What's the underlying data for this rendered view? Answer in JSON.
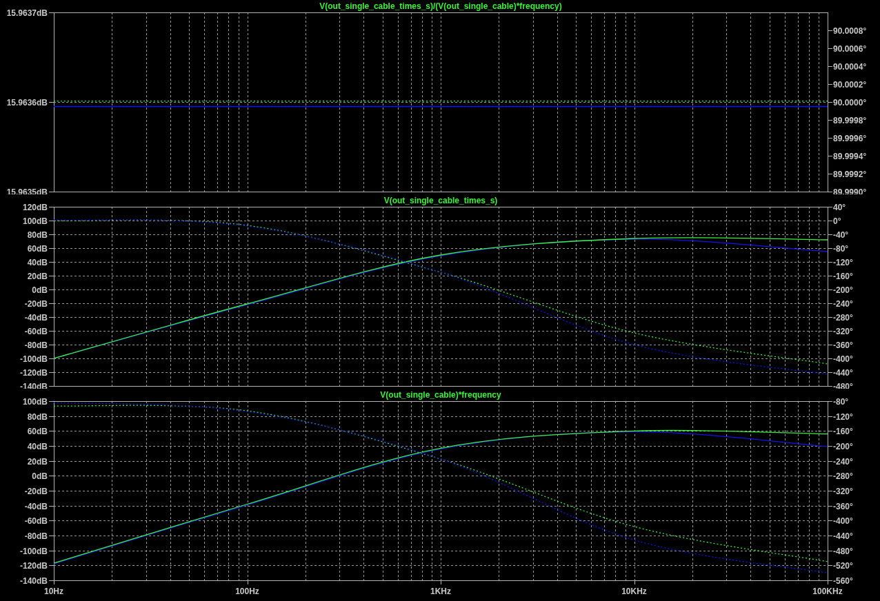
{
  "panes": [
    {
      "chart_data": {
        "type": "line",
        "title": "V(out_single_cable_times_s)/(V(out_single_cable)*frequency)",
        "grid": true,
        "ylim": [
          15.9635,
          15.9637
        ],
        "yticks": [
          {
            "value": 15.9635,
            "label": "15.9635dB"
          },
          {
            "value": 15.9636,
            "label": "15.9636dB"
          },
          {
            "value": 15.9637,
            "label": "15.9637dB"
          }
        ],
        "y2lim": [
          89.999,
          90.001
        ],
        "y2ticks": [
          {
            "value": 89.999,
            "label": "89.9990°"
          },
          {
            "value": 89.9992,
            "label": "89.9992°"
          },
          {
            "value": 89.9994,
            "label": "89.9994°"
          },
          {
            "value": 89.9996,
            "label": "89.9996°"
          },
          {
            "value": 89.9998,
            "label": "89.9998°"
          },
          {
            "value": 90,
            "label": "90.0000°"
          },
          {
            "value": 90.0002,
            "label": "90.0002°"
          },
          {
            "value": 90.0004,
            "label": "90.0004°"
          },
          {
            "value": 90.0006,
            "label": "90.0006°"
          },
          {
            "value": 90.0008,
            "label": "90.0008°"
          }
        ],
        "series": [
          {
            "color": "#1414e6",
            "values": [
              15.963595,
              15.963595,
              15.963595,
              15.963595,
              15.963595
            ]
          },
          {
            "color": "#1414e6",
            "axis": "y2",
            "line_style": "dashed",
            "values": [
              89.99995,
              89.99995,
              89.99995,
              89.99995,
              89.99995
            ]
          },
          {
            "color": "#3cf03c",
            "axis": "y2",
            "line_style": "dashed",
            "values": [
              90.00001,
              90.00001,
              90.00001,
              90.00001,
              90.00001
            ]
          }
        ]
      }
    },
    {
      "chart_data": {
        "type": "line",
        "title": "V(out_single_cable_times_s)",
        "grid": true,
        "ylim": [
          -140,
          120
        ],
        "yticks": [
          {
            "value": 120,
            "label": "120dB"
          },
          {
            "value": 100,
            "label": "100dB"
          },
          {
            "value": 80,
            "label": "80dB"
          },
          {
            "value": 60,
            "label": "60dB"
          },
          {
            "value": 40,
            "label": "40dB"
          },
          {
            "value": 20,
            "label": "20dB"
          },
          {
            "value": 0,
            "label": "0dB"
          },
          {
            "value": -20,
            "label": "-20dB"
          },
          {
            "value": -40,
            "label": "-40dB"
          },
          {
            "value": -60,
            "label": "-60dB"
          },
          {
            "value": -80,
            "label": "-80dB"
          },
          {
            "value": -100,
            "label": "-100dB"
          },
          {
            "value": -120,
            "label": "-120dB"
          },
          {
            "value": -140,
            "label": "-140dB"
          }
        ],
        "y2lim": [
          -480,
          40
        ],
        "y2ticks": [
          {
            "value": 40,
            "label": "40°"
          },
          {
            "value": 0,
            "label": "0°"
          },
          {
            "value": -40,
            "label": "-40°"
          },
          {
            "value": -80,
            "label": "-80°"
          },
          {
            "value": -120,
            "label": "-120°"
          },
          {
            "value": -160,
            "label": "-160°"
          },
          {
            "value": -200,
            "label": "-200°"
          },
          {
            "value": -240,
            "label": "-240°"
          },
          {
            "value": -280,
            "label": "-280°"
          },
          {
            "value": -320,
            "label": "-320°"
          },
          {
            "value": -360,
            "label": "-360°"
          },
          {
            "value": -400,
            "label": "-400°"
          },
          {
            "value": -440,
            "label": "-440°"
          },
          {
            "value": -480,
            "label": "-480°"
          }
        ],
        "series": [
          {
            "color": "#1414e6",
            "values": [
              -100,
              -22,
              49,
              73,
              55
            ]
          },
          {
            "color": "#3cf03c",
            "values": [
              -100,
              -21,
              50,
              74,
              72
            ]
          },
          {
            "color": "#3cf03c",
            "axis": "y2",
            "line_style": "dashed",
            "values": [
              0,
              -14,
              -150,
              -326,
              -416
            ]
          },
          {
            "color": "#1414e6",
            "axis": "y2",
            "line_style": "dashed",
            "values": [
              2,
              -16,
              -150,
              -360,
              -446
            ]
          }
        ]
      }
    },
    {
      "chart_data": {
        "type": "line",
        "title": "V(out_single_cable)*frequency",
        "grid": true,
        "categories": [
          "10Hz",
          "100Hz",
          "1KHz",
          "10KHz",
          "100KHz"
        ],
        "ylim": [
          -140,
          100
        ],
        "yticks": [
          {
            "value": 100,
            "label": "100dB"
          },
          {
            "value": 80,
            "label": "80dB"
          },
          {
            "value": 60,
            "label": "60dB"
          },
          {
            "value": 40,
            "label": "40dB"
          },
          {
            "value": 20,
            "label": "20dB"
          },
          {
            "value": 0,
            "label": "0dB"
          },
          {
            "value": -20,
            "label": "-20dB"
          },
          {
            "value": -40,
            "label": "-40dB"
          },
          {
            "value": -60,
            "label": "-60dB"
          },
          {
            "value": -80,
            "label": "-80dB"
          },
          {
            "value": -100,
            "label": "-100dB"
          },
          {
            "value": -120,
            "label": "-120dB"
          },
          {
            "value": -140,
            "label": "-140dB"
          }
        ],
        "y2lim": [
          -560,
          -80
        ],
        "y2ticks": [
          {
            "value": -80,
            "label": "-80°"
          },
          {
            "value": -120,
            "label": "-120°"
          },
          {
            "value": -160,
            "label": "-160°"
          },
          {
            "value": -200,
            "label": "-200°"
          },
          {
            "value": -240,
            "label": "-240°"
          },
          {
            "value": -280,
            "label": "-280°"
          },
          {
            "value": -320,
            "label": "-320°"
          },
          {
            "value": -360,
            "label": "-360°"
          },
          {
            "value": -400,
            "label": "-400°"
          },
          {
            "value": -440,
            "label": "-440°"
          },
          {
            "value": -480,
            "label": "-480°"
          },
          {
            "value": -520,
            "label": "-520°"
          },
          {
            "value": -560,
            "label": "-560°"
          }
        ],
        "series": [
          {
            "color": "#1414e6",
            "values": [
              -118,
              -39,
              36,
              59,
              39
            ]
          },
          {
            "color": "#3cf03c",
            "values": [
              -117,
              -38,
              37,
              60,
              56
            ]
          },
          {
            "color": "#3cf03c",
            "axis": "y2",
            "line_style": "dashed",
            "values": [
              -93,
              -106,
              -235,
              -416,
              -510
            ]
          },
          {
            "color": "#1414e6",
            "axis": "y2",
            "line_style": "dashed",
            "values": [
              -84,
              -108,
              -235,
              -452,
              -540
            ]
          }
        ]
      }
    }
  ]
}
